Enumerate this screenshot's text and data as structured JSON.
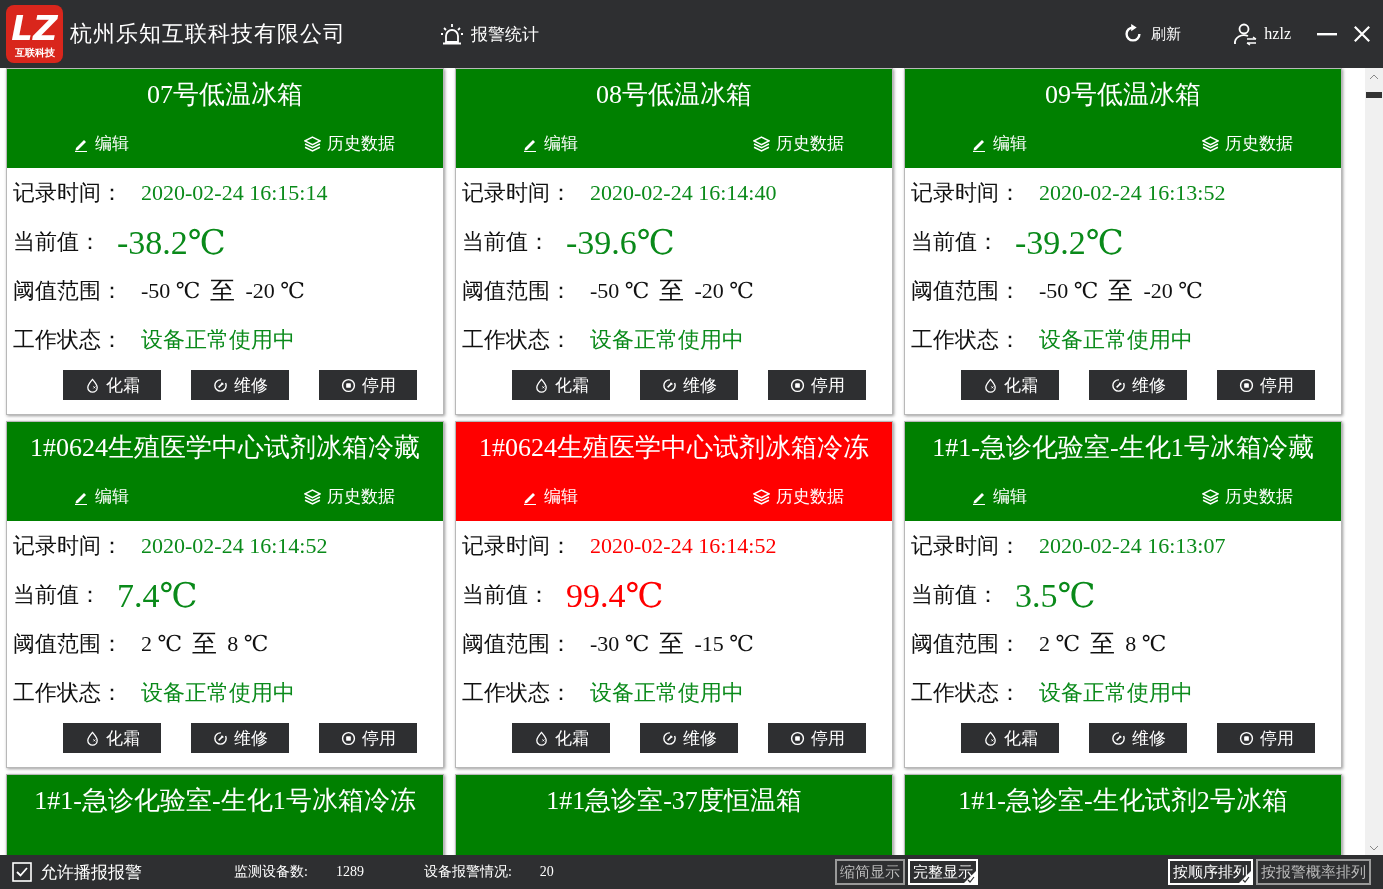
{
  "header": {
    "logo_caption": "互联科技",
    "logo_mark": "LZ",
    "company": "杭州乐知互联科技有限公司",
    "alarm_stats": "报警统计",
    "refresh": "刷新",
    "user": "hzlz"
  },
  "devices": [
    {
      "title": "07号低温冰箱",
      "alarm": false,
      "edit": "编辑",
      "history": "历史数据",
      "time_label": "记录时间：",
      "time": "2020-02-24  16:15:14",
      "value_label": "当前值：",
      "value": "-38.2℃",
      "range_label": "阈值范围：",
      "range_low": "-50 ℃",
      "range_to": "至",
      "range_high": "-20 ℃",
      "status_label": "工作状态：",
      "status": "设备正常使用中",
      "actions": [
        "化霜",
        "维修",
        "停用"
      ]
    },
    {
      "title": "08号低温冰箱",
      "alarm": false,
      "edit": "编辑",
      "history": "历史数据",
      "time_label": "记录时间：",
      "time": "2020-02-24  16:14:40",
      "value_label": "当前值：",
      "value": "-39.6℃",
      "range_label": "阈值范围：",
      "range_low": "-50 ℃",
      "range_to": "至",
      "range_high": "-20 ℃",
      "status_label": "工作状态：",
      "status": "设备正常使用中",
      "actions": [
        "化霜",
        "维修",
        "停用"
      ]
    },
    {
      "title": "09号低温冰箱",
      "alarm": false,
      "edit": "编辑",
      "history": "历史数据",
      "time_label": "记录时间：",
      "time": "2020-02-24  16:13:52",
      "value_label": "当前值：",
      "value": "-39.2℃",
      "range_label": "阈值范围：",
      "range_low": "-50 ℃",
      "range_to": "至",
      "range_high": "-20 ℃",
      "status_label": "工作状态：",
      "status": "设备正常使用中",
      "actions": [
        "化霜",
        "维修",
        "停用"
      ]
    },
    {
      "title": "1#0624生殖医学中心试剂冰箱冷藏",
      "alarm": false,
      "edit": "编辑",
      "history": "历史数据",
      "time_label": "记录时间：",
      "time": "2020-02-24  16:14:52",
      "value_label": "当前值：",
      "value": "7.4℃",
      "range_label": "阈值范围：",
      "range_low": "2 ℃",
      "range_to": "至",
      "range_high": "8 ℃",
      "status_label": "工作状态：",
      "status": "设备正常使用中",
      "actions": [
        "化霜",
        "维修",
        "停用"
      ]
    },
    {
      "title": "1#0624生殖医学中心试剂冰箱冷冻",
      "alarm": true,
      "edit": "编辑",
      "history": "历史数据",
      "time_label": "记录时间：",
      "time": "2020-02-24  16:14:52",
      "value_label": "当前值：",
      "value": "99.4℃",
      "range_label": "阈值范围：",
      "range_low": "-30 ℃",
      "range_to": "至",
      "range_high": "-15 ℃",
      "status_label": "工作状态：",
      "status": "设备正常使用中",
      "actions": [
        "化霜",
        "维修",
        "停用"
      ]
    },
    {
      "title": "1#1-急诊化验室-生化1号冰箱冷藏",
      "alarm": false,
      "edit": "编辑",
      "history": "历史数据",
      "time_label": "记录时间：",
      "time": "2020-02-24  16:13:07",
      "value_label": "当前值：",
      "value": "3.5℃",
      "range_label": "阈值范围：",
      "range_low": "2 ℃",
      "range_to": "至",
      "range_high": "8 ℃",
      "status_label": "工作状态：",
      "status": "设备正常使用中",
      "actions": [
        "化霜",
        "维修",
        "停用"
      ]
    },
    {
      "title": "1#1-急诊化验室-生化1号冰箱冷冻",
      "alarm": false
    },
    {
      "title": "1#1急诊室-37度恒温箱",
      "alarm": false
    },
    {
      "title": "1#1-急诊室-生化试剂2号冰箱",
      "alarm": false
    }
  ],
  "footer": {
    "broadcast": {
      "label": "允许播报报警",
      "checked": true
    },
    "count_label": "监测设备数:",
    "count": "1289",
    "alarm_label": "设备报警情况:",
    "alarm_count": "20",
    "views": [
      {
        "label": "缩简显示",
        "selected": false
      },
      {
        "label": "完整显示",
        "selected": true
      }
    ],
    "sorts": [
      {
        "label": "按顺序排列",
        "selected": true
      },
      {
        "label": "按报警概率排列",
        "selected": false
      }
    ]
  }
}
